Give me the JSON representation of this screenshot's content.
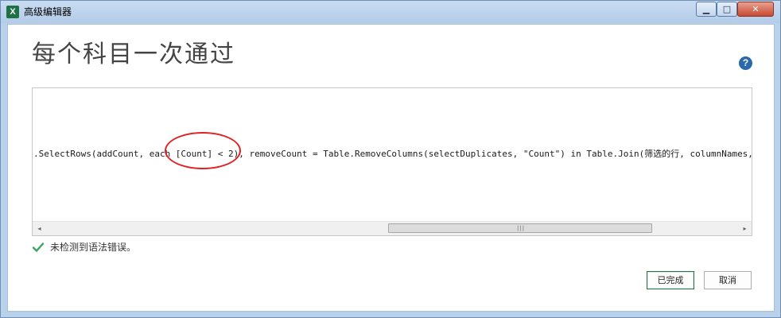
{
  "window": {
    "title": "高级编辑器",
    "icon": "excel-icon",
    "controls": {
      "minimize": "minimize-icon",
      "maximize": "maximize-icon",
      "close": "close-icon"
    }
  },
  "heading": "每个科目一次通过",
  "editor": {
    "code": ".SelectRows(addCount, each [Count] < 2), removeCount = Table.RemoveColumns(selectDuplicates, \"Count\") in Table.Join(筛选的行, columnNames,",
    "annotation_color": "#e02121",
    "scroll_left_glyph": "◂",
    "scroll_right_glyph": "▸",
    "grip_glyph": "|||"
  },
  "status": {
    "icon": "green-checkmark-icon",
    "text": "未检测到语法错误。",
    "color": "#3aa563"
  },
  "buttons": {
    "done": "已完成",
    "cancel": "取消"
  },
  "colors": {
    "accent": "#2a6f4b",
    "help": "#2a6aac",
    "titlebar": "#b9d1ea"
  }
}
